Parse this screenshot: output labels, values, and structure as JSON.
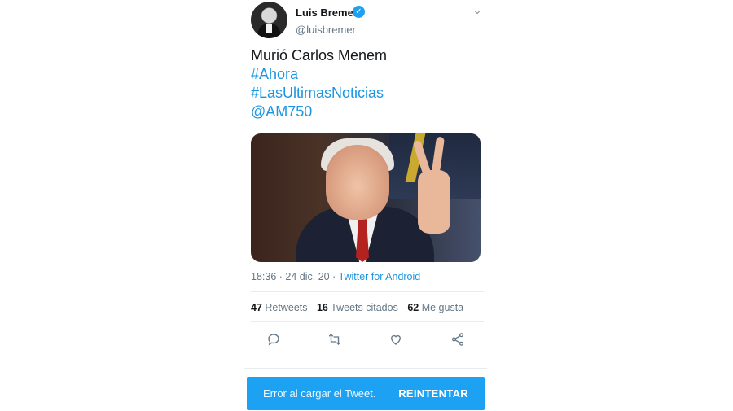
{
  "tweet": {
    "author": {
      "name": "Luis Bremer",
      "handle": "@luisbremer",
      "verified_icon": "verified-badge-icon",
      "menu_icon": "chevron-down-icon"
    },
    "text_lines": [
      {
        "text": "Murió Carlos Menem",
        "kind": "text"
      },
      {
        "text": "#Ahora",
        "kind": "hashtag"
      },
      {
        "text": "#LasUltimasNoticias",
        "kind": "hashtag"
      },
      {
        "text": "@AM750",
        "kind": "mention"
      }
    ],
    "meta": {
      "time": "18:36",
      "separator": " · ",
      "date": "24 dic. 20",
      "source_separator": " · ",
      "source": "Twitter for Android"
    },
    "stats": {
      "retweets_count": "47",
      "retweets_label": "Retweets",
      "quotes_count": "16",
      "quotes_label": "Tweets citados",
      "likes_count": "62",
      "likes_label": "Me gusta"
    },
    "actions": [
      "reply-icon",
      "retweet-icon",
      "like-icon",
      "share-icon"
    ]
  },
  "error_bar": {
    "message": "Error al cargar el Tweet.",
    "retry_label": "REINTENTAR"
  },
  "colors": {
    "accent": "#1da1f2",
    "link": "#1b95e0",
    "muted": "#657786",
    "text": "#14171a"
  }
}
